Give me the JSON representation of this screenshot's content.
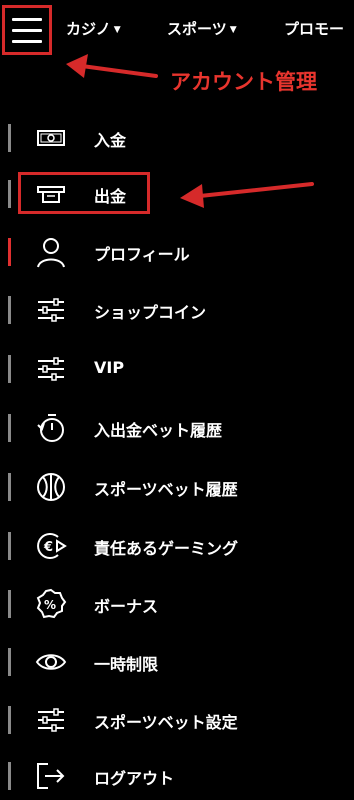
{
  "header": {
    "nav": [
      {
        "label": "カジノ"
      },
      {
        "label": "スポーツ"
      },
      {
        "label": "プロモー"
      }
    ]
  },
  "annotation": {
    "account_label": "アカウント管理",
    "color": "#e8352e"
  },
  "menu": {
    "items": [
      {
        "label": "入金",
        "icon": "cash-icon"
      },
      {
        "label": "出金",
        "icon": "atm-icon"
      },
      {
        "label": "プロフィール",
        "icon": "user-icon",
        "active": true
      },
      {
        "label": "ショップコイン",
        "icon": "sliders-icon"
      },
      {
        "label": "VIP",
        "icon": "sliders-icon"
      },
      {
        "label": "入出金ベット履歴",
        "icon": "timer-icon"
      },
      {
        "label": "スポーツベット履歴",
        "icon": "ball-icon"
      },
      {
        "label": "責任あるゲーミング",
        "icon": "euro-coin-icon"
      },
      {
        "label": "ボーナス",
        "icon": "percent-badge-icon"
      },
      {
        "label": "一時制限",
        "icon": "eye-icon"
      },
      {
        "label": "スポーツベット設定",
        "icon": "sliders-icon"
      },
      {
        "label": "ログアウト",
        "icon": "logout-icon"
      }
    ]
  }
}
